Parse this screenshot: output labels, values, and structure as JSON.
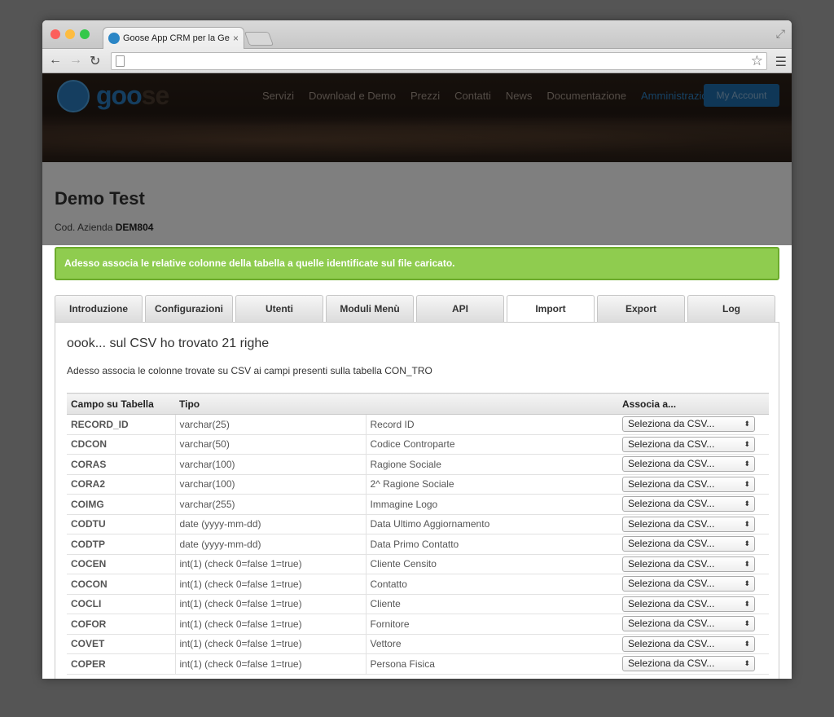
{
  "browser": {
    "tab_title": "Goose App CRM per la Ge",
    "tab_close": "×"
  },
  "site": {
    "logo_goo": "goo",
    "logo_se": "se",
    "nav": [
      "Servizi",
      "Download e Demo",
      "Prezzi",
      "Contatti",
      "News",
      "Documentazione",
      "Amministrazione"
    ],
    "nav_active": "Amministrazione",
    "account_label": "My Account"
  },
  "page": {
    "title": "Demo Test",
    "company_label": "Cod. Azienda",
    "company_code": "DEM804"
  },
  "alert": {
    "text": "Adesso associa le relative colonne della tabella a quelle identificate sul file caricato."
  },
  "tabs": [
    "Introduzione",
    "Configurazioni",
    "Utenti",
    "Moduli Menù",
    "API",
    "Import",
    "Export",
    "Log"
  ],
  "active_tab": "Import",
  "panel": {
    "title": "oook... sul CSV ho trovato 21 righe",
    "description": "Adesso associa le colonne trovate su CSV ai campi presenti sulla tabella CON_TRO"
  },
  "table": {
    "headers": [
      "Campo su Tabella",
      "Tipo",
      "",
      "Associa a..."
    ],
    "select_placeholder": "Seleziona da CSV...",
    "rows": [
      {
        "field": "RECORD_ID",
        "type": "varchar(25)",
        "label": "Record ID"
      },
      {
        "field": "CDCON",
        "type": "varchar(50)",
        "label": "Codice Controparte"
      },
      {
        "field": "CORAS",
        "type": "varchar(100)",
        "label": "Ragione Sociale"
      },
      {
        "field": "CORA2",
        "type": "varchar(100)",
        "label": "2^ Ragione Sociale"
      },
      {
        "field": "COIMG",
        "type": "varchar(255)",
        "label": "Immagine Logo"
      },
      {
        "field": "CODTU",
        "type": "date (yyyy-mm-dd)",
        "label": "Data Ultimo Aggiornamento"
      },
      {
        "field": "CODTP",
        "type": "date (yyyy-mm-dd)",
        "label": "Data Primo Contatto"
      },
      {
        "field": "COCEN",
        "type": "int(1) (check 0=false 1=true)",
        "label": "Cliente Censito"
      },
      {
        "field": "COCON",
        "type": "int(1) (check 0=false 1=true)",
        "label": "Contatto"
      },
      {
        "field": "COCLI",
        "type": "int(1) (check 0=false 1=true)",
        "label": "Cliente"
      },
      {
        "field": "COFOR",
        "type": "int(1) (check 0=false 1=true)",
        "label": "Fornitore"
      },
      {
        "field": "COVET",
        "type": "int(1) (check 0=false 1=true)",
        "label": "Vettore"
      },
      {
        "field": "COPER",
        "type": "int(1) (check 0=false 1=true)",
        "label": "Persona Fisica"
      }
    ]
  },
  "colors": {
    "alert_bg": "#8fcc4f",
    "brand_blue": "#2a7cc0"
  }
}
